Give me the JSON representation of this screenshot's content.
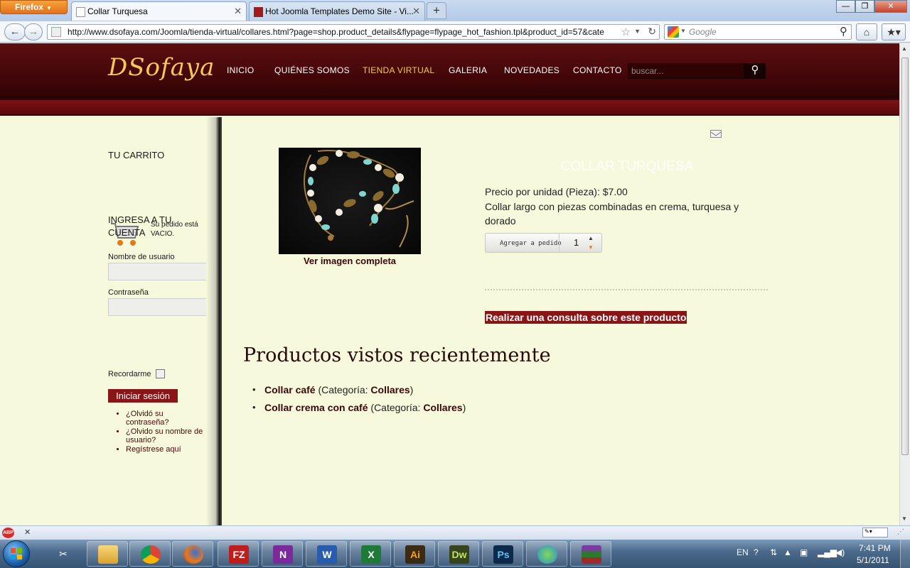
{
  "browser": {
    "app_button": "Firefox",
    "tabs": [
      {
        "title": "Collar Turquesa",
        "active": true
      },
      {
        "title": "Hot Joomla Templates Demo Site - Vi...",
        "active": false
      }
    ],
    "new_tab": "+",
    "url": "http://www.dsofaya.com/Joomla/tienda-virtual/collares.html?page=shop.product_details&flypage=flypage_hot_fashion.tpl&product_id=57&cate",
    "search_placeholder": "Google",
    "window_controls": {
      "minimize": "—",
      "maximize": "❐",
      "close": "✕"
    }
  },
  "site": {
    "logo": "DSofaya",
    "menu": [
      "INICIO",
      "QUIÉNES SOMOS",
      "TIENDA VIRTUAL",
      "GALERIA",
      "NOVEDADES",
      "CONTACTO"
    ],
    "active_menu": "TIENDA VIRTUAL",
    "search_placeholder": "buscar..."
  },
  "sidebar": {
    "cart_title": "TU CARRITO",
    "cart_message": "Su pedido está VACIO.",
    "login_title": "INGRESA A TU CUENTA",
    "username_label": "Nombre de usuario",
    "password_label": "Contraseña",
    "remember_label": "Recordarme",
    "login_button": "Iniciar sesión",
    "links": [
      "¿Olvidó su contraseña?",
      "¿Olvido su nombre de usuario?",
      "Regístrese aquí"
    ]
  },
  "product": {
    "title": "COLLAR TURQUESA",
    "view_image": "Ver imagen completa",
    "price": "Precio por unidad (Pieza): $7.00",
    "description": "Collar largo con piezas combinadas en crema, turquesa y dorado",
    "add_to_cart": "Agregar a pedido",
    "quantity": "1",
    "enquiry": "Realizar una consulta sobre este producto"
  },
  "recent": {
    "heading": "Productos vistos recientemente",
    "category_prefix": "(Categoría: ",
    "items": [
      {
        "name": "Collar café",
        "category": "Collares"
      },
      {
        "name": "Collar crema con café",
        "category": "Collares"
      }
    ]
  },
  "addon_bar": {
    "abp": "ABP",
    "close": "✕"
  },
  "taskbar": {
    "apps": [
      "Explorer",
      "Chrome",
      "Firefox",
      "FileZilla",
      "OneNote",
      "Word",
      "Excel",
      "Illustrator",
      "Dreamweaver",
      "Photoshop",
      "Messenger",
      "WinRAR"
    ],
    "app_labels": {
      "filezilla": "FZ",
      "onenote": "N",
      "word": "W",
      "excel": "X",
      "illustrator": "Ai",
      "dreamweaver": "Dw",
      "photoshop": "Ps"
    },
    "language": "EN",
    "time": "7:41 PM",
    "date": "5/1/2011"
  },
  "colors": {
    "header": "#3e0507",
    "accent_gold": "#f5c857",
    "page_bg": "#f6f9dc",
    "brand_red": "#8a1517"
  }
}
